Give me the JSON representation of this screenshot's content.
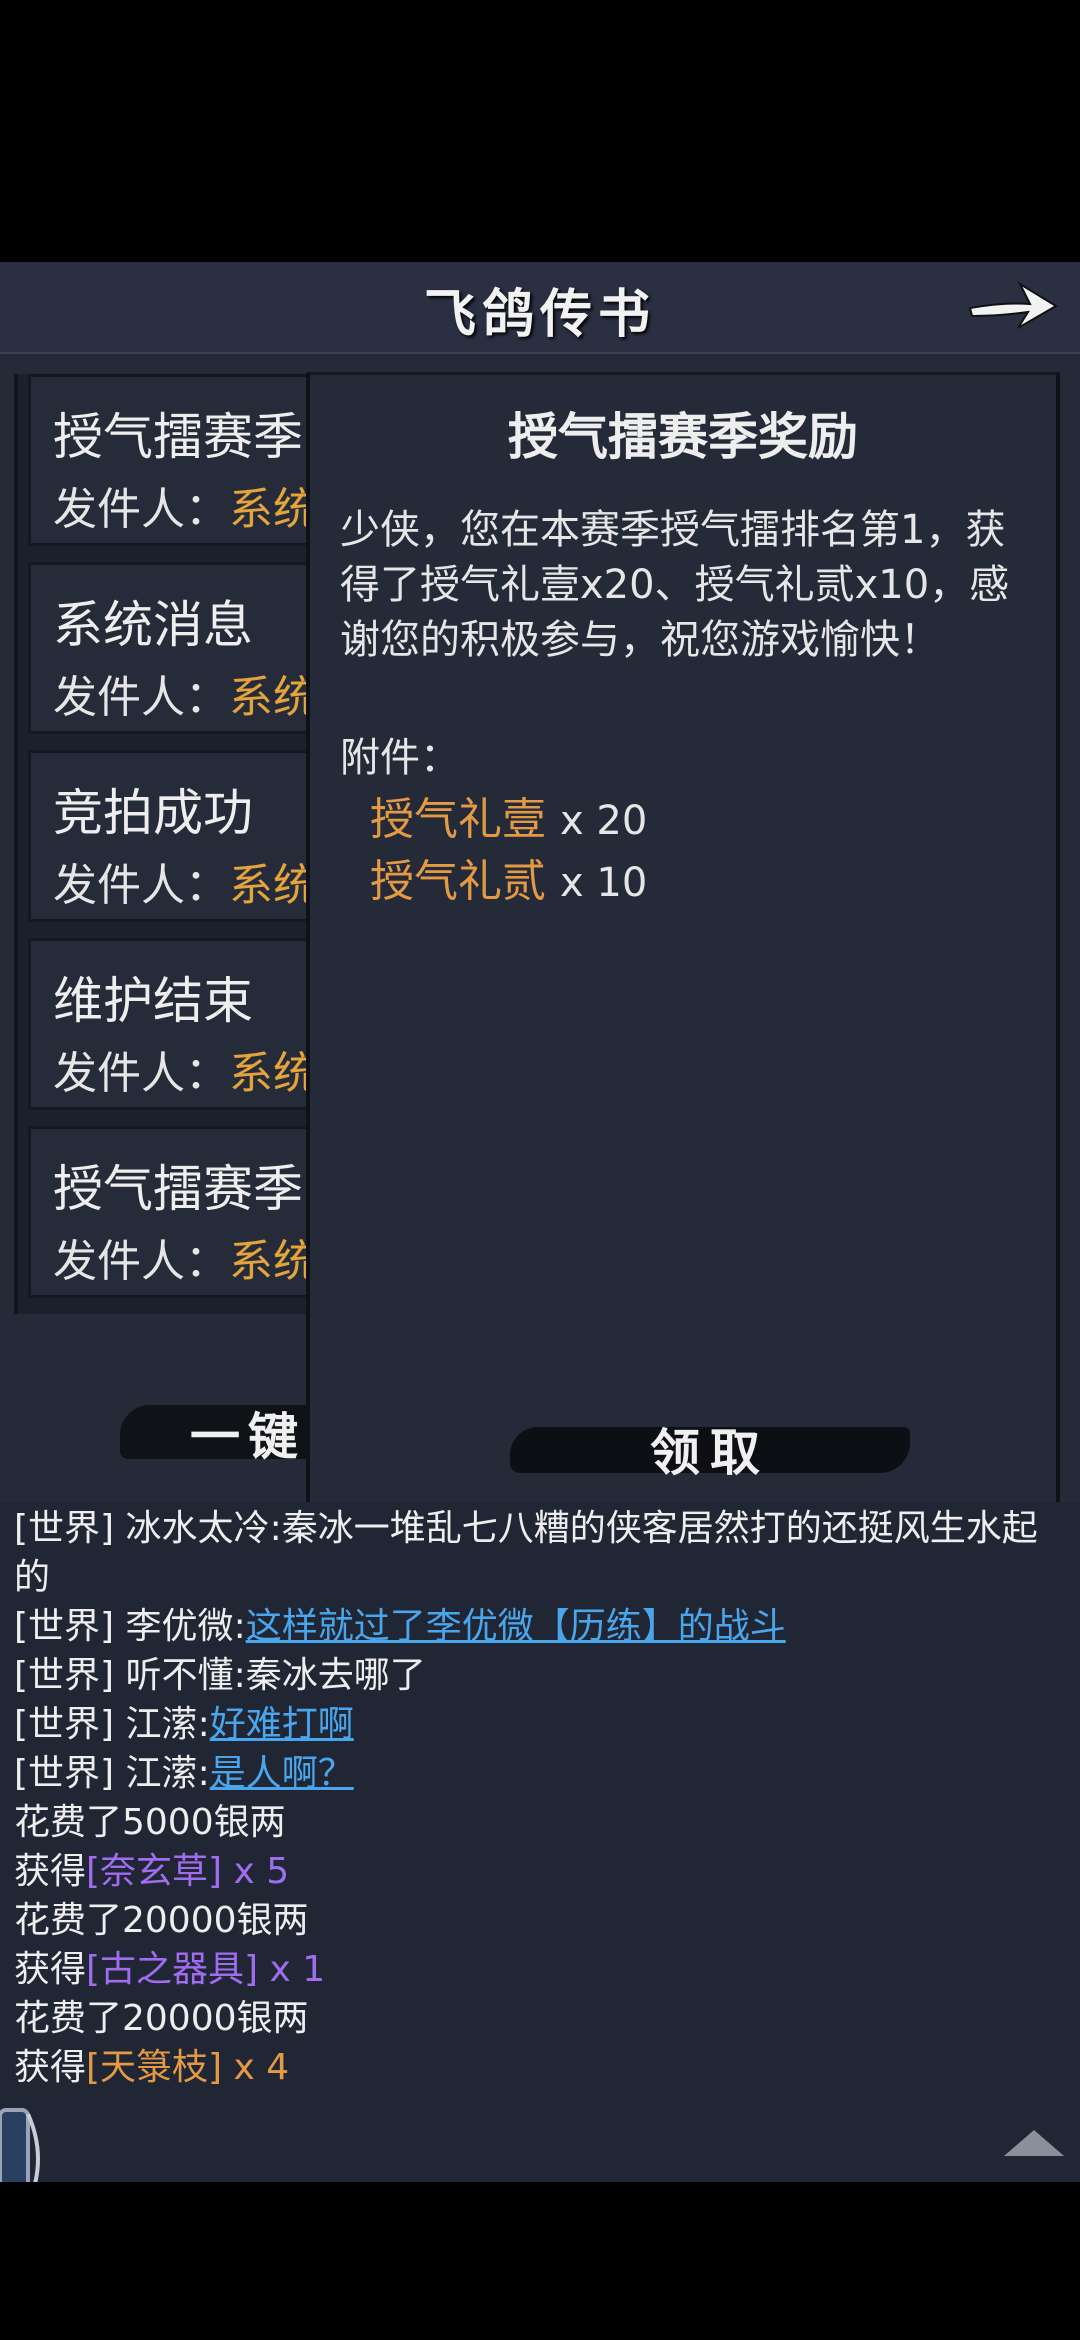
{
  "window": {
    "title": "飞鸽传书"
  },
  "mail_list": [
    {
      "title": "授气擂赛季",
      "sender_label": "发件人：",
      "sender": "系统"
    },
    {
      "title": "系统消息",
      "sender_label": "发件人：",
      "sender": "系统"
    },
    {
      "title": "竞拍成功",
      "sender_label": "发件人：",
      "sender": "系统"
    },
    {
      "title": "维护结束",
      "sender_label": "发件人：",
      "sender": "系统"
    },
    {
      "title": "授气擂赛季",
      "sender_label": "发件人：",
      "sender": "系统"
    }
  ],
  "one_key_label": "一键",
  "detail": {
    "title": "授气擂赛季奖励",
    "body": "少侠，您在本赛季授气擂排名第1，获得了授气礼壹x20、授气礼贰x10，感谢您的积极参与，祝您游戏愉快！",
    "attach_label": "附件：",
    "attachments": [
      {
        "name": "授气礼壹",
        "qty": "x 20"
      },
      {
        "name": "授气礼贰",
        "qty": "x 10"
      }
    ],
    "claim_label": "领取"
  },
  "chat": {
    "lines": [
      {
        "prefix": "[世界]",
        "user": "冰水太冷",
        "message": "秦冰一堆乱七八糟的侠客居然打的还挺风生水起",
        "wrap": "的"
      },
      {
        "prefix": "[世界]",
        "user": "李优微",
        "message": "这样就过了李优微【历练】的战斗"
      },
      {
        "prefix": "[世界]",
        "user": "听不懂",
        "message": "秦冰去哪了"
      },
      {
        "prefix": "[世界]",
        "user": "江潆",
        "message": "好难打啊"
      },
      {
        "prefix": "[世界]",
        "user": "江潆",
        "message": "是人啊？"
      },
      {
        "text": "花费了5000银两"
      },
      {
        "gain": "获得",
        "item": "[奈玄草]",
        "qty": " x 5"
      },
      {
        "text": "花费了20000银两"
      },
      {
        "gain": "获得",
        "item": "[古之器具]",
        "qty": " x 1"
      },
      {
        "text": "花费了20000银两"
      },
      {
        "gain": "获得",
        "item": "[天箓枝]",
        "qty": " x 4"
      }
    ]
  },
  "colors": {
    "sender": "#e4a43c",
    "attachment": "#e49a45",
    "link": "#4aa6ec",
    "rare_item": "#a06cf0"
  }
}
